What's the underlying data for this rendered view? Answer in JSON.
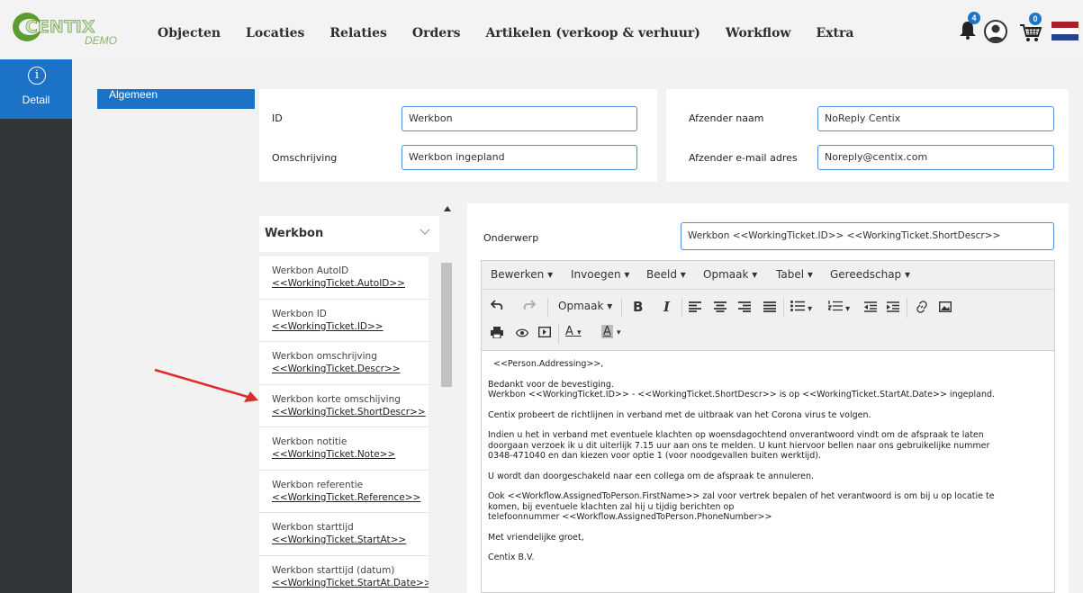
{
  "brand": {
    "name": "CENTIX",
    "sub": "DEMO"
  },
  "nav": {
    "items": [
      "Objecten",
      "Locaties",
      "Relaties",
      "Orders",
      "Artikelen (verkoop & verhuur)",
      "Workflow",
      "Extra"
    ]
  },
  "header_icons": {
    "notification_count": "4",
    "cart_count": "0",
    "colors": {
      "badge": "#1e74c6",
      "flag_red": "#ae1c28",
      "flag_white": "#ffffff",
      "flag_blue": "#21468b"
    }
  },
  "sidebar": {
    "detail_label": "Detail",
    "detail_icon": "i"
  },
  "tab": {
    "label": "Algemeen"
  },
  "form": {
    "id_label": "ID",
    "id_value": "Werkbon",
    "omschrijving_label": "Omschrijving",
    "omschrijving_value": "Werkbon ingepland",
    "afzender_naam_label": "Afzender naam",
    "afzender_naam_value": "NoReply Centix",
    "afzender_email_label": "Afzender e-mail adres",
    "afzender_email_value": "Noreply@centix.com"
  },
  "list": {
    "title": "Werkbon",
    "items": [
      {
        "title": "Werkbon AutoID",
        "tag": "<<WorkingTicket.AutoID>>"
      },
      {
        "title": "Werkbon ID",
        "tag": "<<WorkingTicket.ID>>"
      },
      {
        "title": "Werkbon omschrijving",
        "tag": "<<WorkingTicket.Descr>>"
      },
      {
        "title": "Werkbon korte omschijving",
        "tag": "<<WorkingTicket.ShortDescr>>"
      },
      {
        "title": "Werkbon notitie",
        "tag": "<<WorkingTicket.Note>>"
      },
      {
        "title": "Werkbon referentie",
        "tag": "<<WorkingTicket.Reference>>"
      },
      {
        "title": "Werkbon starttijd",
        "tag": "<<WorkingTicket.StartAt>>"
      },
      {
        "title": "Werkbon starttijd (datum)",
        "tag": "<<WorkingTicket.StartAt.Date>>"
      }
    ]
  },
  "editor": {
    "subject_label": "Onderwerp",
    "subject_value": "Werkbon <<WorkingTicket.ID>> <<WorkingTicket.ShortDescr>>",
    "menus": [
      "Bewerken",
      "Invoegen",
      "Beeld",
      "Opmaak",
      "Tabel",
      "Gereedschap"
    ],
    "format_label": "Opmaak",
    "bold_label": "B",
    "italic_label": "I",
    "font_color_label": "A",
    "bg_color_label": "A",
    "paragraphs": [
      "<<Person.Addressing>>,",
      "Bedankt voor de bevestiging.",
      "Werkbon <<WorkingTicket.ID>> - <<WorkingTicket.ShortDescr>> is op <<WorkingTicket.StartAt.Date>> ingepland.",
      "Centix probeert de richtlijnen in verband met de uitbraak van het Corona virus te volgen.",
      "Indien u het in verband met eventuele klachten op woensdagochtend onverantwoord vindt om de afspraak te laten",
      "doorgaan verzoek ik u dit uiterlijk 7.15 uur aan ons te melden. U kunt hiervoor bellen naar ons gebruikelijke nummer",
      "0348-471040 en dan kiezen voor optie 1 (voor noodgevallen buiten werktijd).",
      "U wordt dan doorgeschakeld naar een collega om de afspraak te annuleren.",
      "Ook <<Workflow.AssignedToPerson.FirstName>> zal voor vertrek bepalen of het verantwoord is om bij u op locatie te",
      "komen, bij eventuele klachten zal hij u tijdig berichten op",
      "telefoonnummer  <<Workflow.AssignedToPerson.PhoneNumber>>",
      "Met vriendelijke groet,",
      "Centix B.V."
    ]
  }
}
